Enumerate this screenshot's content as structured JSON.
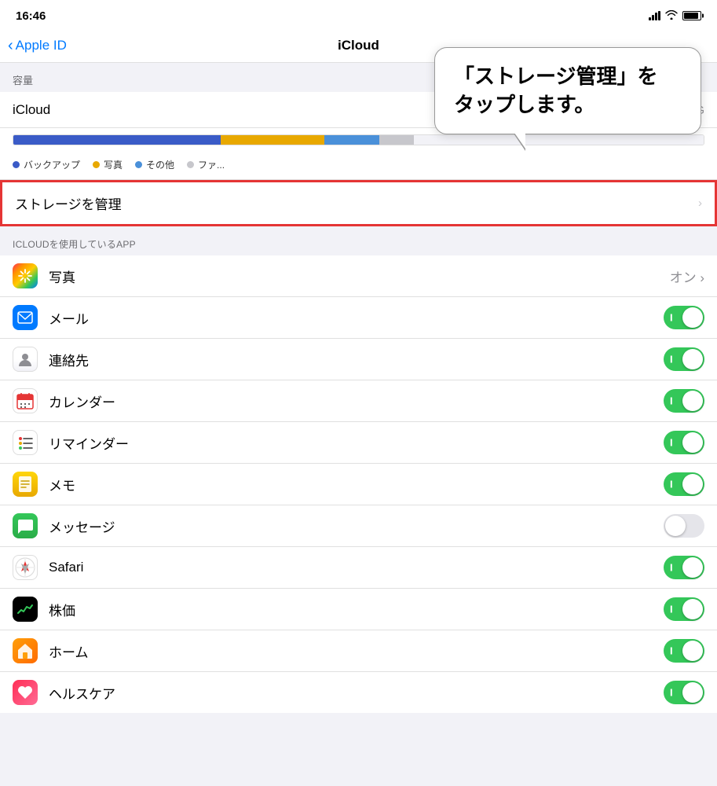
{
  "statusBar": {
    "time": "16:46",
    "timeArrow": "↗"
  },
  "navBar": {
    "backLabel": "Apple ID",
    "title": "iCloud"
  },
  "tooltip": {
    "text": "「ストレージ管理」を\nタップします。"
  },
  "storageSection": {
    "label": "容量",
    "icloudLabel": "iCloud",
    "usageLabel": "使用済み: 61.8 G"
  },
  "storageLegend": [
    {
      "color": "#3a5bc7",
      "label": "バックアップ"
    },
    {
      "color": "#e8a800",
      "label": "写真"
    },
    {
      "color": "#4a90d9",
      "label": "その他"
    },
    {
      "color": "#aaa",
      "label": "ファ..."
    }
  ],
  "storageBar": [
    {
      "color": "#3a5bc7",
      "width": "30%"
    },
    {
      "color": "#e8a800",
      "width": "15%"
    },
    {
      "color": "#4a90d9",
      "width": "8%"
    },
    {
      "color": "#c7c7cc",
      "width": "5%"
    },
    {
      "color": "#f2f2f7",
      "width": "42%"
    }
  ],
  "manageRow": {
    "label": "ストレージを管理",
    "chevron": "›"
  },
  "appsSection": {
    "label": "ICLOUDを使用しているAPP"
  },
  "apps": [
    {
      "id": "photos",
      "name": "写真",
      "icon": "photos",
      "toggleState": "on-label",
      "onLabel": "オン"
    },
    {
      "id": "mail",
      "name": "メール",
      "icon": "mail",
      "toggleState": "on"
    },
    {
      "id": "contacts",
      "name": "連絡先",
      "icon": "contacts",
      "toggleState": "on"
    },
    {
      "id": "calendar",
      "name": "カレンダー",
      "icon": "calendar",
      "toggleState": "on"
    },
    {
      "id": "reminders",
      "name": "リマインダー",
      "icon": "reminders",
      "toggleState": "on"
    },
    {
      "id": "notes",
      "name": "メモ",
      "icon": "notes",
      "toggleState": "on"
    },
    {
      "id": "messages",
      "name": "メッセージ",
      "icon": "messages",
      "toggleState": "off"
    },
    {
      "id": "safari",
      "name": "Safari",
      "icon": "safari",
      "toggleState": "on"
    },
    {
      "id": "stocks",
      "name": "株価",
      "icon": "stocks",
      "toggleState": "on"
    },
    {
      "id": "home",
      "name": "ホーム",
      "icon": "home",
      "toggleState": "on"
    },
    {
      "id": "health",
      "name": "ヘルスケア",
      "icon": "health",
      "toggleState": "on"
    }
  ]
}
